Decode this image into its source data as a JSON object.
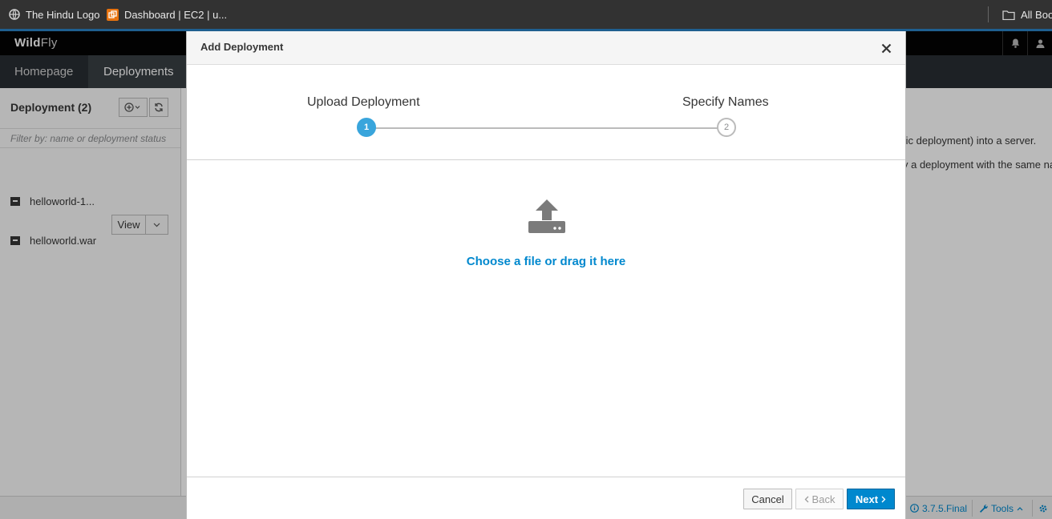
{
  "bookmarks": {
    "items": [
      {
        "label": "The Hindu Logo",
        "icon": "globe-icon"
      },
      {
        "label": "Dashboard | EC2 | u...",
        "icon": "aws-icon"
      }
    ],
    "all_bookmarks": "All Boo"
  },
  "app": {
    "logo_bold": "Wild",
    "logo_light": "Fly",
    "nav": [
      {
        "label": "Homepage"
      },
      {
        "label": "Deployments"
      }
    ],
    "sidebar": {
      "title": "Deployment (2)",
      "filter_placeholder": "Filter by: name or deployment status",
      "deployments": [
        {
          "name": "helloworld-1..."
        },
        {
          "name": "helloworld.war"
        }
      ],
      "view_label": "View"
    },
    "content": {
      "line1": "fic deployment) into a server.",
      "line2": "y a deployment with the same na"
    },
    "footer": {
      "version": "3.7.5.Final",
      "tools": "Tools"
    }
  },
  "modal": {
    "title": "Add Deployment",
    "steps": [
      {
        "label": "Upload Deployment",
        "number": "1",
        "state": "active"
      },
      {
        "label": "Specify Names",
        "number": "2",
        "state": "inactive"
      }
    ],
    "upload_text": "Choose a file or drag it here",
    "buttons": {
      "cancel": "Cancel",
      "back": "Back",
      "next": "Next"
    }
  },
  "colors": {
    "accent": "#0088ce",
    "step_active": "#39a5dc",
    "navbar": "#292e34"
  }
}
